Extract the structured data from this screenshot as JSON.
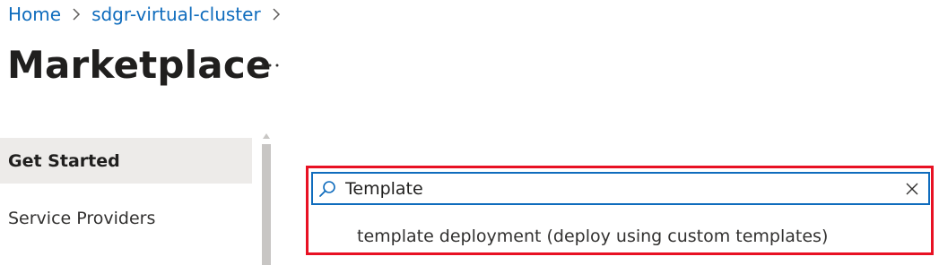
{
  "breadcrumb": {
    "items": [
      {
        "label": "Home"
      },
      {
        "label": "sdgr-virtual-cluster"
      }
    ]
  },
  "page": {
    "title": "Marketplace",
    "more_label": "…"
  },
  "nav": {
    "items": [
      {
        "label": "Get Started",
        "active": true
      },
      {
        "label": "Service Providers",
        "active": false
      }
    ]
  },
  "search": {
    "value": "Template",
    "icon": "search-icon",
    "clear_icon": "close-icon",
    "suggestions": [
      {
        "label": "template deployment (deploy using custom templates)"
      }
    ]
  },
  "colors": {
    "link": "#0f6cbd",
    "highlight_border": "#e81123",
    "active_nav_bg": "#edebe9",
    "focus_border": "#0f6cbd"
  }
}
